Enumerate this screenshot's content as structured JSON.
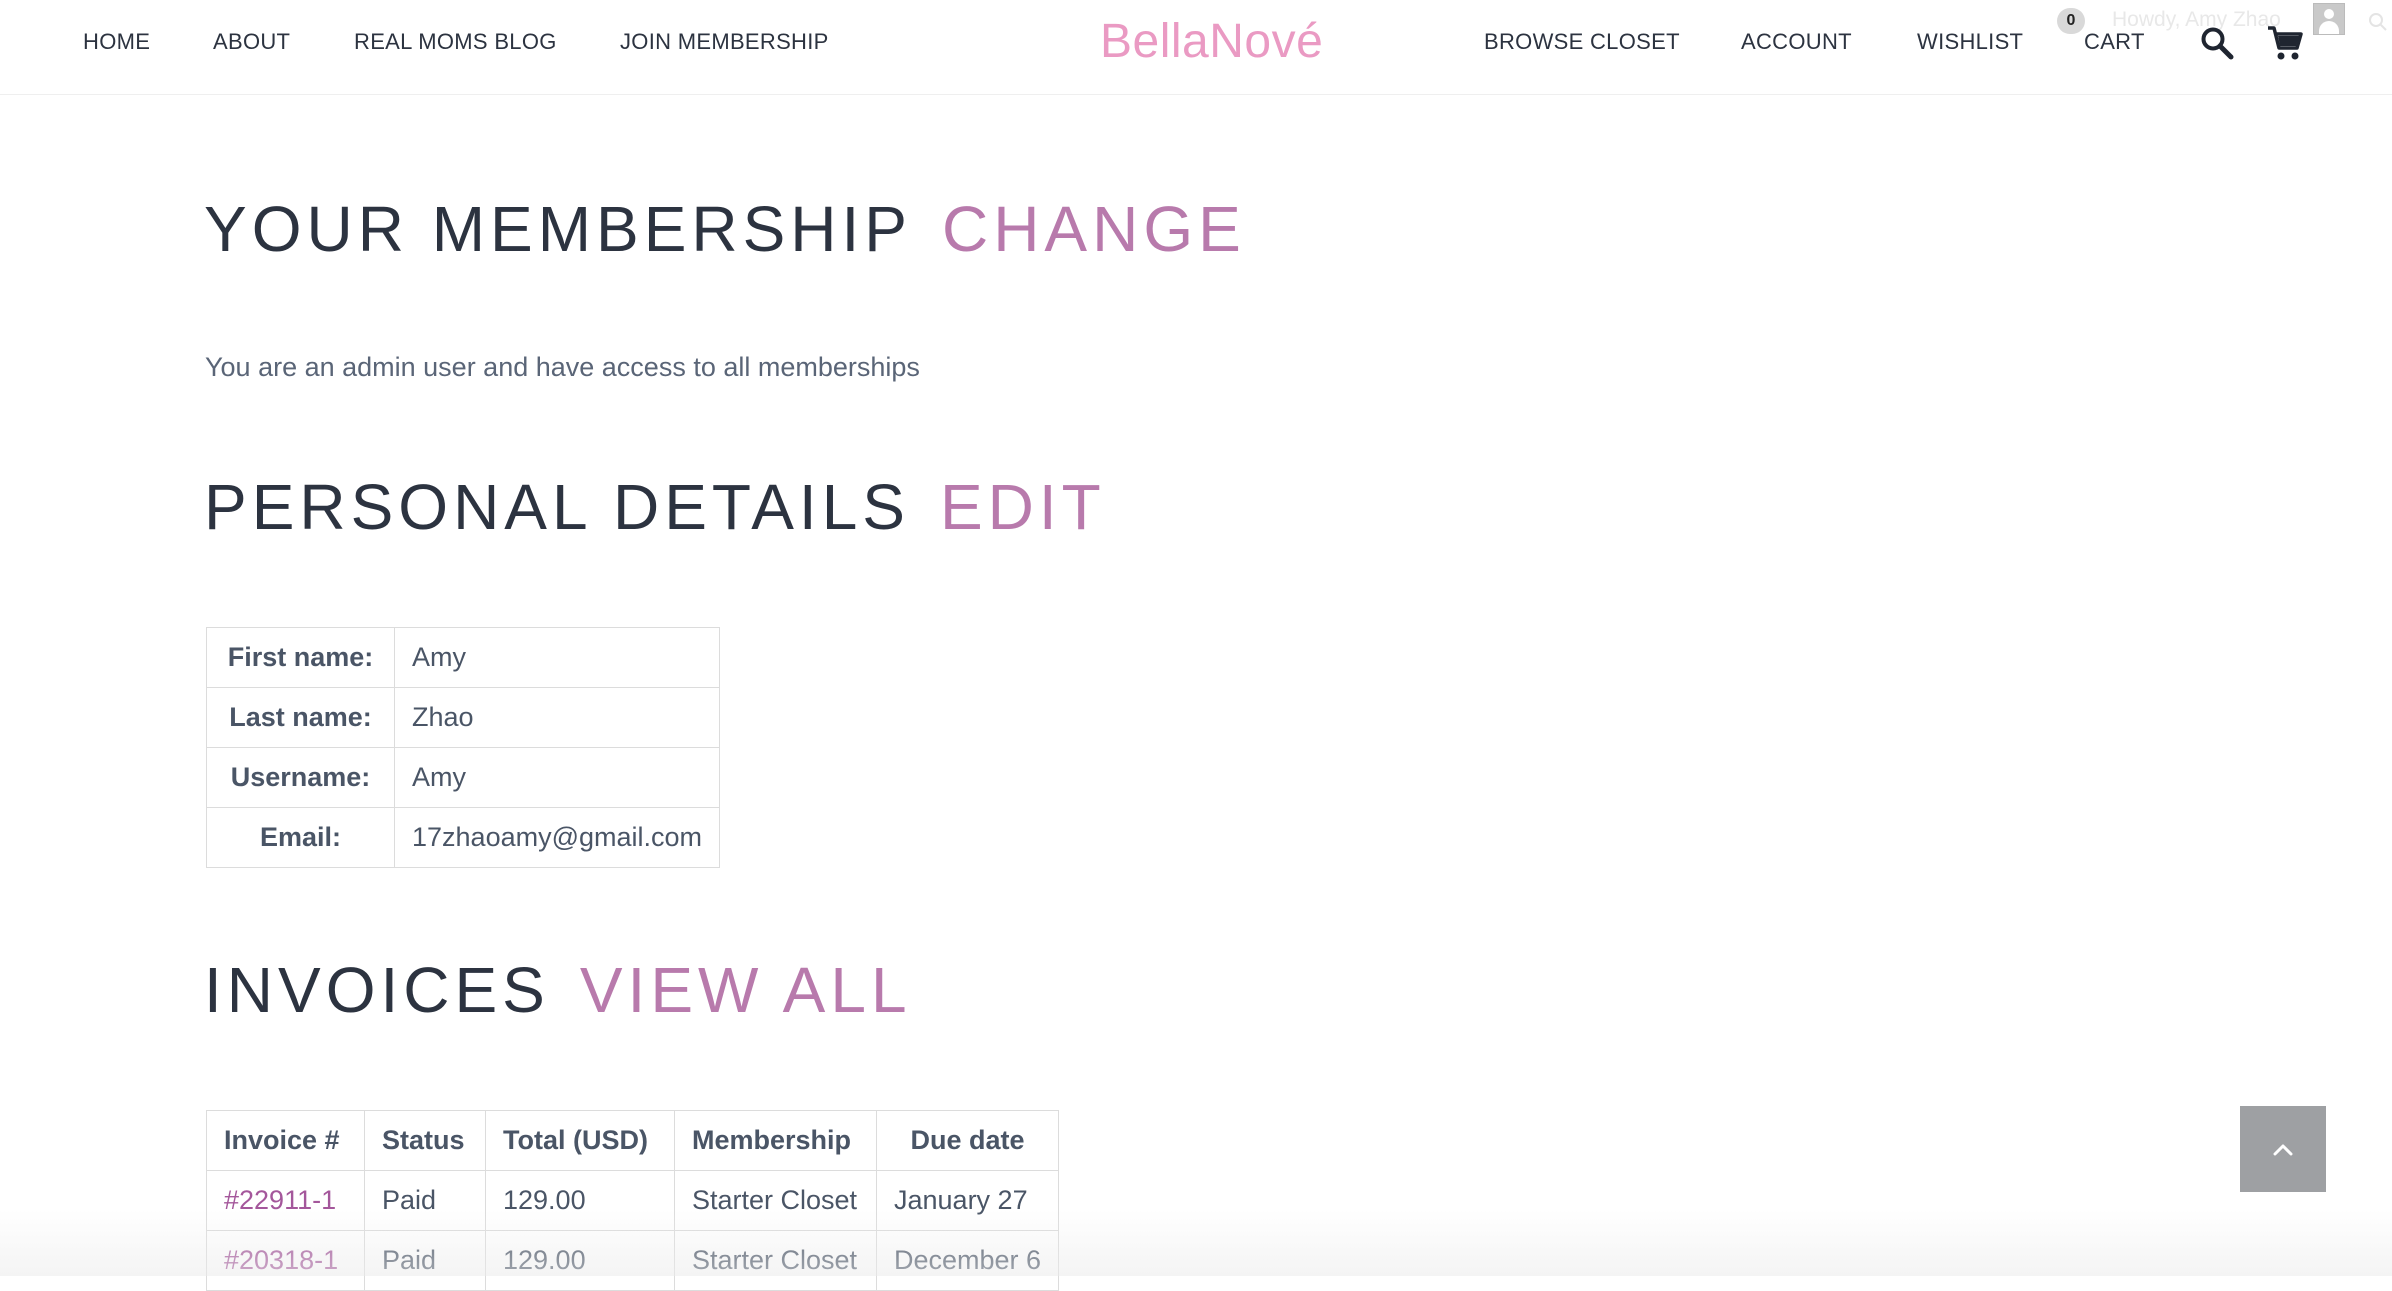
{
  "nav": {
    "left": [
      "HOME",
      "ABOUT",
      "REAL MOMS BLOG",
      "JOIN MEMBERSHIP"
    ],
    "right": [
      "BROWSE CLOSET",
      "ACCOUNT",
      "WISHLIST",
      "CART"
    ],
    "logo": "BellaNové",
    "cart_count": "0",
    "howdy": "Howdy, Amy Zhao",
    "icons": [
      "search-icon",
      "cart-icon",
      "avatar-icon",
      "search-icon"
    ]
  },
  "membership": {
    "title": "YOUR MEMBERSHIP",
    "action": "CHANGE",
    "note": "You are an admin user and have access to all memberships"
  },
  "personal": {
    "title": "PERSONAL DETAILS",
    "action": "EDIT",
    "rows": [
      {
        "label": "First name:",
        "value": "Amy"
      },
      {
        "label": "Last name:",
        "value": "Zhao"
      },
      {
        "label": "Username:",
        "value": "Amy"
      },
      {
        "label": "Email:",
        "value": "17zhaoamy@gmail.com"
      }
    ]
  },
  "invoices": {
    "title": "INVOICES",
    "action": "VIEW ALL",
    "headers": [
      "Invoice #",
      "Status",
      "Total (USD)",
      "Membership",
      "Due date"
    ],
    "rows": [
      [
        "#22911-1",
        "Paid",
        "129.00",
        "Starter Closet",
        "January 27"
      ],
      [
        "#20318-1",
        "Paid",
        "129.00",
        "Starter Closet",
        "December 6"
      ]
    ]
  },
  "colors": {
    "accent": "#b87aac",
    "logo": "#ea9ac3",
    "invoice_link": "#a4579b",
    "heading": "#2c3340",
    "body_text": "#4a5566",
    "scroll_button": "#9ea0a3"
  }
}
